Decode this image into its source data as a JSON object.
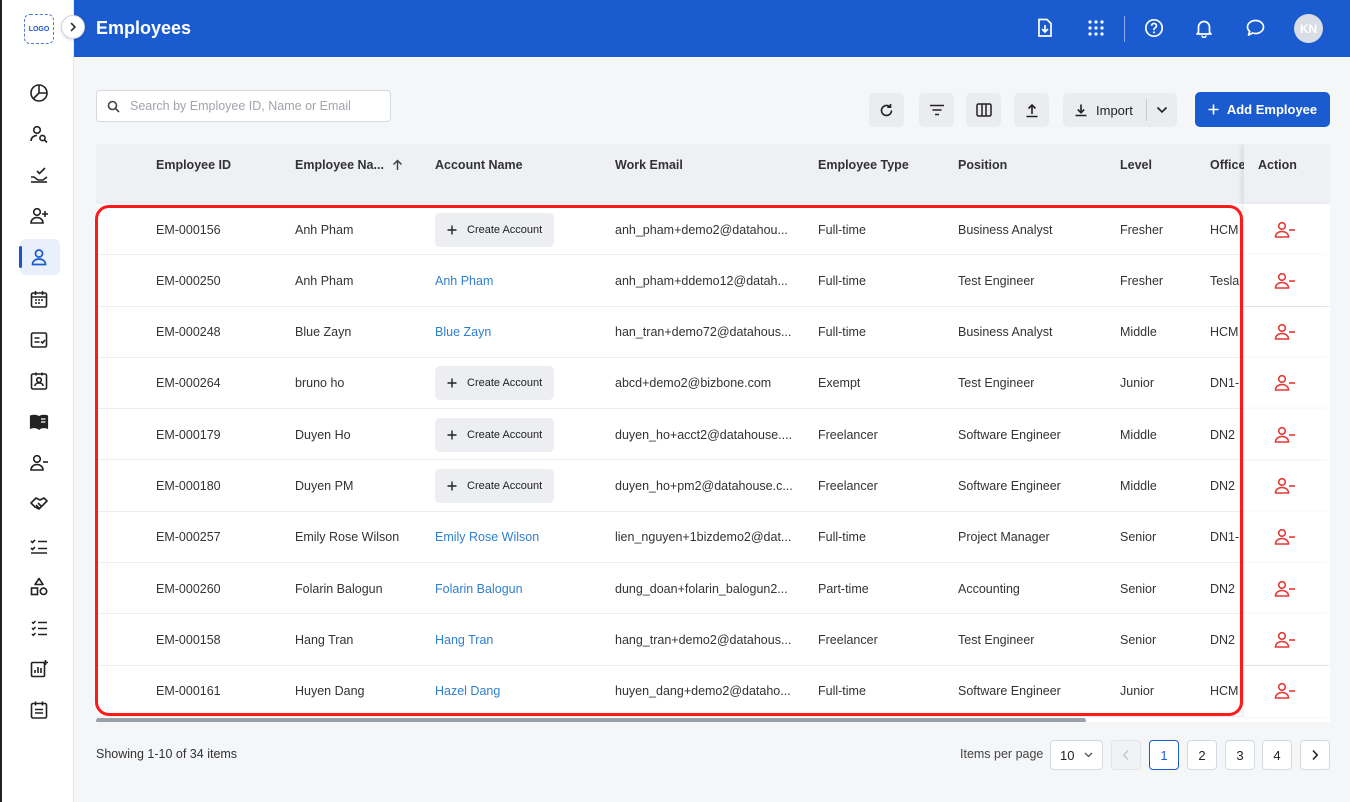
{
  "app": {
    "logo_text": "LOGO",
    "page_title": "Employees",
    "avatar_initials": "KN"
  },
  "sidebar": {
    "items": [
      {
        "icon": "dashboard-icon"
      },
      {
        "icon": "user-search-icon"
      },
      {
        "icon": "hand-check-icon"
      },
      {
        "icon": "user-add-icon"
      },
      {
        "icon": "employee-icon",
        "active": true
      },
      {
        "icon": "calendar-icon"
      },
      {
        "icon": "checklist-card-icon"
      },
      {
        "icon": "user-badge-icon"
      },
      {
        "icon": "book-icon"
      },
      {
        "icon": "user-remove-icon"
      },
      {
        "icon": "handshake-icon"
      },
      {
        "icon": "task-list-icon"
      },
      {
        "icon": "shapes-icon"
      },
      {
        "icon": "list-check-icon"
      },
      {
        "icon": "chart-add-icon"
      },
      {
        "icon": "event-note-icon"
      }
    ]
  },
  "toolbar": {
    "search_placeholder": "Search by Employee ID, Name or Email",
    "import_label": "Import",
    "add_label": "Add Employee"
  },
  "table": {
    "columns": {
      "employee_id": "Employee ID",
      "employee_name": "Employee Na...",
      "account_name": "Account Name",
      "work_email": "Work Email",
      "employee_type": "Employee Type",
      "position": "Position",
      "level": "Level",
      "office": "Office",
      "action": "Action"
    },
    "create_account_label": "Create Account",
    "rows": [
      {
        "id": "EM-000156",
        "name": "Anh Pham",
        "account": "",
        "email": "anh_pham+demo2@datahou...",
        "type": "Full-time",
        "position": "Business Analyst",
        "level": "Fresher",
        "office": "HCM"
      },
      {
        "id": "EM-000250",
        "name": "Anh Pham",
        "account": "Anh Pham",
        "email": "anh_pham+ddemo12@datah...",
        "type": "Full-time",
        "position": "Test Engineer",
        "level": "Fresher",
        "office": "Tesla"
      },
      {
        "id": "EM-000248",
        "name": "Blue Zayn",
        "account": "Blue Zayn",
        "email": "han_tran+demo72@datahous...",
        "type": "Full-time",
        "position": "Business Analyst",
        "level": "Middle",
        "office": "HCM"
      },
      {
        "id": "EM-000264",
        "name": "bruno ho",
        "account": "",
        "email": "abcd+demo2@bizbone.com",
        "type": "Exempt",
        "position": "Test Engineer",
        "level": "Junior",
        "office": "DN1-"
      },
      {
        "id": "EM-000179",
        "name": "Duyen Ho",
        "account": "",
        "email": "duyen_ho+acct2@datahouse....",
        "type": "Freelancer",
        "position": "Software Engineer",
        "level": "Middle",
        "office": "DN2"
      },
      {
        "id": "EM-000180",
        "name": "Duyen PM",
        "account": "",
        "email": "duyen_ho+pm2@datahouse.c...",
        "type": "Freelancer",
        "position": "Software Engineer",
        "level": "Middle",
        "office": "DN2"
      },
      {
        "id": "EM-000257",
        "name": "Emily Rose Wilson",
        "account": "Emily Rose Wilson",
        "email": "lien_nguyen+1bizdemo2@dat...",
        "type": "Full-time",
        "position": "Project Manager",
        "level": "Senior",
        "office": "DN1-"
      },
      {
        "id": "EM-000260",
        "name": "Folarin Balogun",
        "account": "Folarin Balogun",
        "email": "dung_doan+folarin_balogun2...",
        "type": "Part-time",
        "position": "Accounting",
        "level": "Senior",
        "office": "DN2"
      },
      {
        "id": "EM-000158",
        "name": "Hang Tran",
        "account": "Hang Tran",
        "email": "hang_tran+demo2@datahous...",
        "type": "Freelancer",
        "position": "Test Engineer",
        "level": "Senior",
        "office": "DN2"
      },
      {
        "id": "EM-000161",
        "name": "Huyen Dang",
        "account": "Hazel Dang",
        "email": "huyen_dang+demo2@dataho...",
        "type": "Full-time",
        "position": "Software Engineer",
        "level": "Junior",
        "office": "HCM"
      }
    ]
  },
  "footer": {
    "showing": "Showing 1-10 of 34 items",
    "items_per_page_label": "Items per page",
    "items_per_page": "10",
    "pages": [
      "1",
      "2",
      "3",
      "4"
    ],
    "current_page": "1"
  },
  "colors": {
    "brand": "#1b5bd0",
    "link": "#2f7fd0",
    "danger": "#e53935",
    "highlight": "#ff1a1a"
  }
}
